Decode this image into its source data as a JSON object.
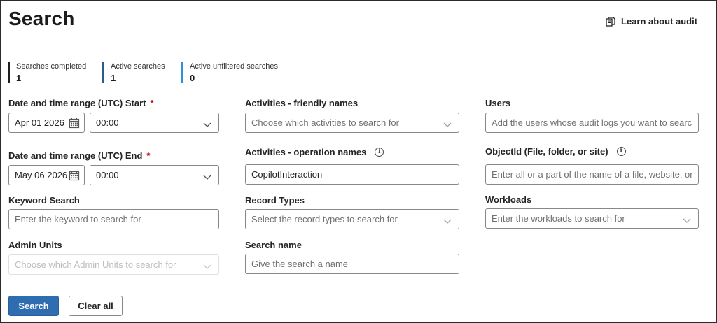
{
  "page": {
    "title": "Search"
  },
  "header": {
    "learn_link": "Learn about audit"
  },
  "stats": [
    {
      "label": "Searches completed",
      "value": "1"
    },
    {
      "label": "Active searches",
      "value": "1"
    },
    {
      "label": "Active unfiltered searches",
      "value": "0"
    }
  ],
  "form": {
    "start": {
      "label": "Date and time range (UTC) Start",
      "required_mark": "*",
      "date": "Apr 01 2026",
      "time": "00:00"
    },
    "end": {
      "label": "Date and time range (UTC) End",
      "required_mark": "*",
      "date": "May 06 2026",
      "time": "00:00"
    },
    "keyword": {
      "label": "Keyword Search",
      "placeholder": "Enter the keyword to search for"
    },
    "admin_units": {
      "label": "Admin Units",
      "placeholder": "Choose which Admin Units to search for"
    },
    "activities_friendly": {
      "label": "Activities - friendly names",
      "placeholder": "Choose which activities to search for"
    },
    "activities_operation": {
      "label": "Activities - operation names",
      "value": "CopilotInteraction"
    },
    "record_types": {
      "label": "Record Types",
      "placeholder": "Select the record types to search for"
    },
    "search_name": {
      "label": "Search name",
      "placeholder": "Give the search a name"
    },
    "users": {
      "label": "Users",
      "placeholder": "Add the users whose audit logs you want to search"
    },
    "object_id": {
      "label": "ObjectId (File, folder, or site)",
      "placeholder": "Enter all or a part of the name of a file, website, or..."
    },
    "workloads": {
      "label": "Workloads",
      "placeholder": "Enter the workloads to search for"
    }
  },
  "actions": {
    "search": "Search",
    "clear": "Clear all"
  },
  "icons": {
    "learn": "document-copy-icon",
    "calendar": "calendar-icon",
    "chevron": "chevron-down-icon",
    "info": "info-icon"
  },
  "colors": {
    "primary_button": "#2f6db1",
    "required": "#c50f1f",
    "stat_bar_1": "#1f1f1f",
    "stat_bar_2": "#2d5a8c",
    "stat_bar_3": "#2f8fdb"
  }
}
